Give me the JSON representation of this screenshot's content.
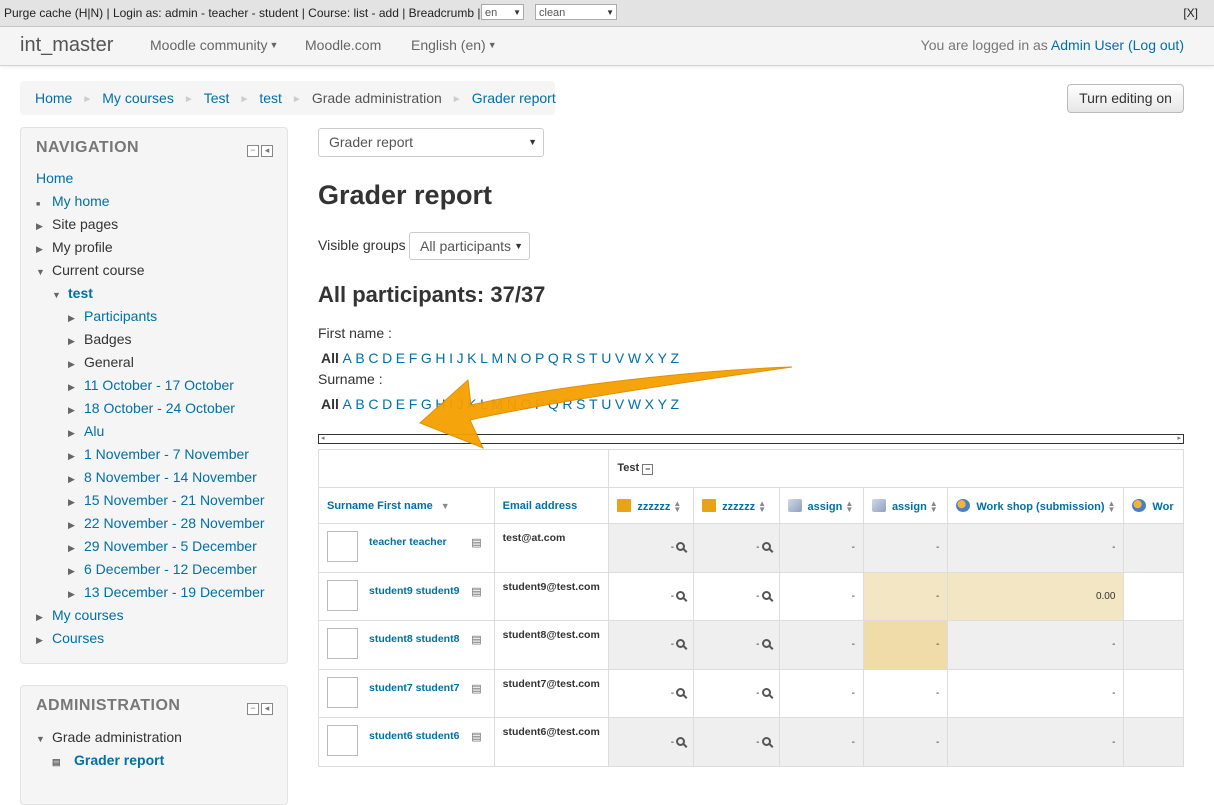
{
  "devbar": {
    "items": "Purge cache (H|N) | Login as: admin - teacher - student | Course: list - add | Breadcrumb |",
    "lang_select": "en",
    "theme_select": "clean",
    "close": "[X]"
  },
  "navbar": {
    "brand": "int_master",
    "links": [
      "Moodle community",
      "Moodle.com",
      "English (en)"
    ],
    "logged_prefix": "You are logged in as ",
    "user": "Admin User",
    "logout": "(Log out)"
  },
  "breadcrumb": [
    "Home",
    "My courses",
    "Test",
    "test",
    "Grade administration",
    "Grader report"
  ],
  "turn_editing": "Turn editing on",
  "navigation": {
    "title": "NAVIGATION",
    "home": "Home",
    "items": [
      {
        "label": "My home",
        "level": 0,
        "link": true,
        "marker": "bullet"
      },
      {
        "label": "Site pages",
        "level": 0,
        "link": false,
        "marker": "right"
      },
      {
        "label": "My profile",
        "level": 0,
        "link": false,
        "marker": "right"
      },
      {
        "label": "Current course",
        "level": 0,
        "link": false,
        "marker": "down"
      },
      {
        "label": "test",
        "level": 1,
        "link": true,
        "marker": "down",
        "bold": true
      },
      {
        "label": "Participants",
        "level": 2,
        "link": true,
        "marker": "right"
      },
      {
        "label": "Badges",
        "level": 2,
        "link": false,
        "marker": "right"
      },
      {
        "label": "General",
        "level": 2,
        "link": false,
        "marker": "right"
      },
      {
        "label": "11 October - 17 October",
        "level": 2,
        "link": true,
        "marker": "right"
      },
      {
        "label": "18 October - 24 October",
        "level": 2,
        "link": true,
        "marker": "right"
      },
      {
        "label": "Alu",
        "level": 2,
        "link": true,
        "marker": "right"
      },
      {
        "label": "1 November - 7 November",
        "level": 2,
        "link": true,
        "marker": "right"
      },
      {
        "label": "8 November - 14 November",
        "level": 2,
        "link": true,
        "marker": "right"
      },
      {
        "label": "15 November - 21 November",
        "level": 2,
        "link": true,
        "marker": "right"
      },
      {
        "label": "22 November - 28 November",
        "level": 2,
        "link": true,
        "marker": "right"
      },
      {
        "label": "29 November - 5 December",
        "level": 2,
        "link": true,
        "marker": "right"
      },
      {
        "label": "6 December - 12 December",
        "level": 2,
        "link": true,
        "marker": "right"
      },
      {
        "label": "13 December - 19 December",
        "level": 2,
        "link": true,
        "marker": "right"
      },
      {
        "label": "My courses",
        "level": 0,
        "link": true,
        "marker": "right"
      },
      {
        "label": "Courses",
        "level": 0,
        "link": true,
        "marker": "right"
      }
    ]
  },
  "administration": {
    "title": "ADMINISTRATION",
    "grade_admin": "Grade administration",
    "grader_report": "Grader report"
  },
  "report_select": "Grader report",
  "page_title": "Grader report",
  "visible_groups_label": "Visible groups",
  "visible_groups_value": "All participants",
  "participants_heading": "All participants: 37/37",
  "first_name_label": "First name :",
  "surname_label": "Surname :",
  "initials": [
    "All",
    "A",
    "B",
    "C",
    "D",
    "E",
    "F",
    "G",
    "H",
    "I",
    "J",
    "K",
    "L",
    "M",
    "N",
    "O",
    "P",
    "Q",
    "R",
    "S",
    "T",
    "U",
    "V",
    "W",
    "X",
    "Y",
    "Z"
  ],
  "grid": {
    "category": "Test",
    "user_col": "Surname First name",
    "email_col": "Email address",
    "items": [
      {
        "label": "zzzzzz",
        "icon": "folder-icon"
      },
      {
        "label": "zzzzzz",
        "icon": "folder-icon"
      },
      {
        "label": "assign",
        "icon": "assignment-icon"
      },
      {
        "label": "assign",
        "icon": "assignment-icon"
      },
      {
        "label": "Work shop (submission)",
        "icon": "workshop-icon"
      },
      {
        "label": "Wor",
        "icon": "workshop-icon"
      }
    ],
    "rows": [
      {
        "name": "teacher teacher",
        "email": "test@at.com",
        "grades": [
          "-",
          "-",
          "-",
          "-",
          "-",
          ""
        ]
      },
      {
        "name": "student9 student9",
        "email": "student9@test.com",
        "grades": [
          "-",
          "-",
          "-",
          "-",
          "0.00",
          ""
        ]
      },
      {
        "name": "student8 student8",
        "email": "student8@test.com",
        "grades": [
          "-",
          "-",
          "-",
          "-",
          "-",
          ""
        ]
      },
      {
        "name": "student7 student7",
        "email": "student7@test.com",
        "grades": [
          "-",
          "-",
          "-",
          "-",
          "-",
          ""
        ]
      },
      {
        "name": "student6 student6",
        "email": "student6@test.com",
        "grades": [
          "-",
          "-",
          "-",
          "-",
          "-",
          ""
        ]
      }
    ]
  }
}
